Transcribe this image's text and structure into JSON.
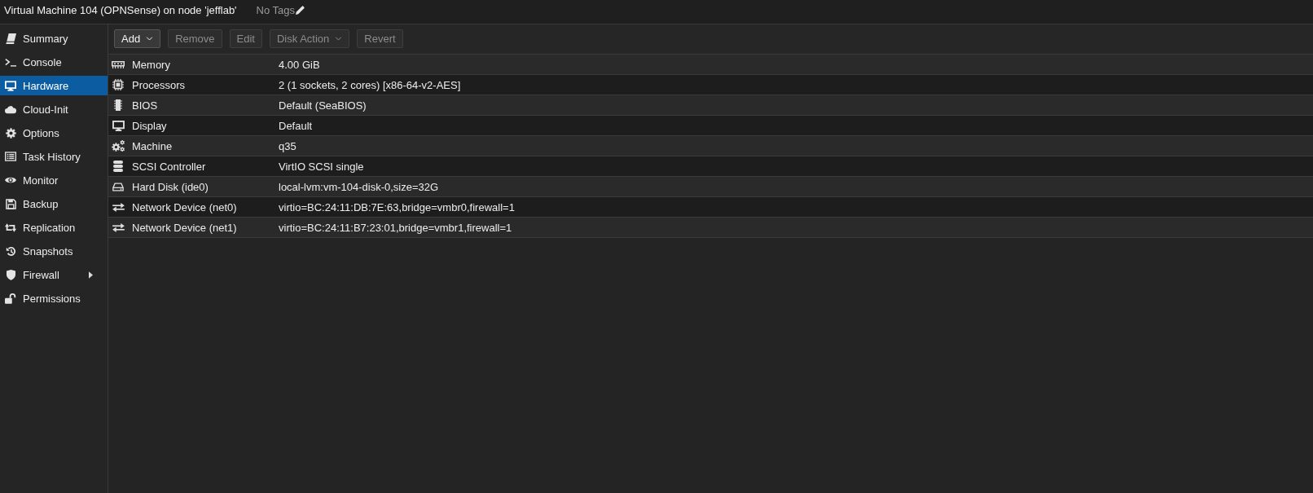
{
  "window": {
    "title": "Virtual Machine 104 (OPNSense) on node 'jefflab'",
    "tags": "No Tags"
  },
  "sidebar": {
    "items": [
      {
        "label": "Summary",
        "selected": false,
        "has_submenu": false
      },
      {
        "label": "Console",
        "selected": false,
        "has_submenu": false
      },
      {
        "label": "Hardware",
        "selected": true,
        "has_submenu": false
      },
      {
        "label": "Cloud-Init",
        "selected": false,
        "has_submenu": false
      },
      {
        "label": "Options",
        "selected": false,
        "has_submenu": false
      },
      {
        "label": "Task History",
        "selected": false,
        "has_submenu": false
      },
      {
        "label": "Monitor",
        "selected": false,
        "has_submenu": false
      },
      {
        "label": "Backup",
        "selected": false,
        "has_submenu": false
      },
      {
        "label": "Replication",
        "selected": false,
        "has_submenu": false
      },
      {
        "label": "Snapshots",
        "selected": false,
        "has_submenu": false
      },
      {
        "label": "Firewall",
        "selected": false,
        "has_submenu": true
      },
      {
        "label": "Permissions",
        "selected": false,
        "has_submenu": false
      }
    ]
  },
  "toolbar": {
    "buttons": [
      {
        "label": "Add",
        "disabled": false,
        "has_menu": true
      },
      {
        "label": "Remove",
        "disabled": true,
        "has_menu": false
      },
      {
        "label": "Edit",
        "disabled": true,
        "has_menu": false
      },
      {
        "label": "Disk Action",
        "disabled": true,
        "has_menu": true
      },
      {
        "label": "Revert",
        "disabled": true,
        "has_menu": false
      }
    ]
  },
  "table": {
    "rows": [
      {
        "name": "Memory",
        "value": "4.00 GiB",
        "selected": false
      },
      {
        "name": "Processors",
        "value": "2 (1 sockets, 2 cores) [x86-64-v2-AES]",
        "selected": false
      },
      {
        "name": "BIOS",
        "value": "Default (SeaBIOS)",
        "selected": false
      },
      {
        "name": "Display",
        "value": "Default",
        "selected": false
      },
      {
        "name": "Machine",
        "value": "q35",
        "selected": false
      },
      {
        "name": "SCSI Controller",
        "value": "VirtIO SCSI single",
        "selected": false
      },
      {
        "name": "Hard Disk (ide0)",
        "value": "local-lvm:vm-104-disk-0,size=32G",
        "selected": false
      },
      {
        "name": "Network Device (net0)",
        "value": "virtio=BC:24:11:DB:7E:63,bridge=vmbr0,firewall=1",
        "selected": false
      },
      {
        "name": "Network Device (net1)",
        "value": "virtio=BC:24:11:B7:23:01,bridge=vmbr1,firewall=1",
        "selected": false
      }
    ]
  }
}
